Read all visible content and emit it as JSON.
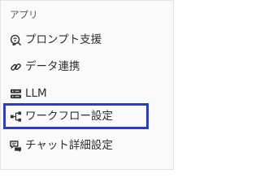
{
  "sidebar": {
    "section_title": "アプリ",
    "items": [
      {
        "label": "プロンプト支援",
        "icon": "prompt-support-icon",
        "active": false
      },
      {
        "label": "データ連携",
        "icon": "link-icon",
        "active": false
      },
      {
        "label": "LLM",
        "icon": "server-icon",
        "active": false
      },
      {
        "label": "ワークフロー設定",
        "icon": "workflow-icon",
        "active": true
      },
      {
        "label": "チャット詳細設定",
        "icon": "chat-settings-icon",
        "active": false
      }
    ]
  },
  "colors": {
    "highlight_border": "#3040a8",
    "text": "#2f2f2f",
    "section_title": "#555555"
  }
}
